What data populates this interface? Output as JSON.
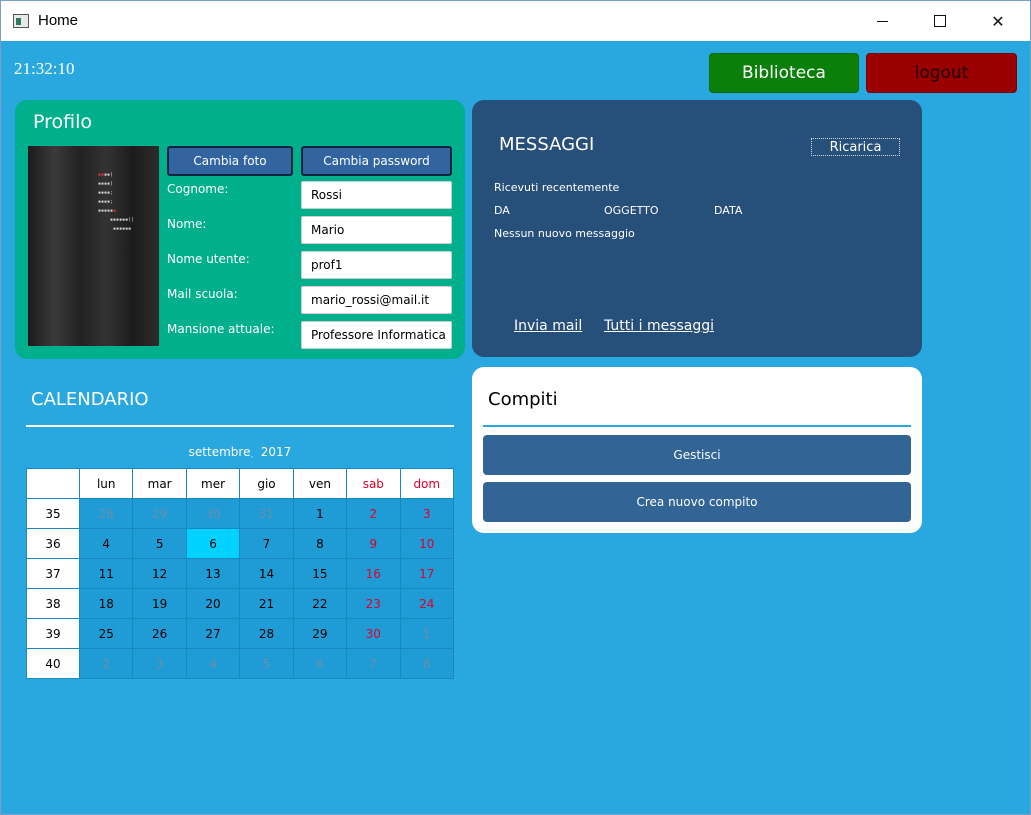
{
  "window": {
    "title": "Home"
  },
  "header": {
    "clock": "21:32:10",
    "biblioteca_label": "Biblioteca",
    "logout_label": "logout"
  },
  "profilo": {
    "title": "Profilo",
    "change_photo": "Cambia foto",
    "change_password": "Cambia password",
    "fields": [
      {
        "label": "Cognome:",
        "value": "Rossi"
      },
      {
        "label": "Nome:",
        "value": "Mario"
      },
      {
        "label": "Nome utente:",
        "value": "prof1"
      },
      {
        "label": "Mail scuola:",
        "value": "mario_rossi@mail.it"
      },
      {
        "label": "Mansione attuale:",
        "value": "Professore Informatica"
      }
    ]
  },
  "messaggi": {
    "title": "MESSAGGI",
    "reload": "Ricarica",
    "recent": "Ricevuti recentemente",
    "col_from": "DA",
    "col_subject": "OGGETTO",
    "col_date": "DATA",
    "empty": "Nessun nuovo messaggio",
    "send_mail": "Invia mail",
    "all_messages": "Tutti i messaggi"
  },
  "compiti": {
    "title": "Compiti",
    "manage": "Gestisci",
    "create": "Crea nuovo compito"
  },
  "calendario": {
    "title": "CALENDARIO",
    "month": "settembre",
    "year": "2017",
    "weekdays": [
      "lun",
      "mar",
      "mer",
      "gio",
      "ven",
      "sab",
      "dom"
    ],
    "weeks": [
      {
        "num": "35",
        "days": [
          "28",
          "29",
          "30",
          "31",
          "1",
          "2",
          "3"
        ]
      },
      {
        "num": "36",
        "days": [
          "4",
          "5",
          "6",
          "7",
          "8",
          "9",
          "10"
        ]
      },
      {
        "num": "37",
        "days": [
          "11",
          "12",
          "13",
          "14",
          "15",
          "16",
          "17"
        ]
      },
      {
        "num": "38",
        "days": [
          "18",
          "19",
          "20",
          "21",
          "22",
          "23",
          "24"
        ]
      },
      {
        "num": "39",
        "days": [
          "25",
          "26",
          "27",
          "28",
          "29",
          "30",
          "1"
        ]
      },
      {
        "num": "40",
        "days": [
          "2",
          "3",
          "4",
          "5",
          "6",
          "7",
          "8"
        ]
      }
    ],
    "selected_day": "6",
    "colors": {
      "weekend": "#e0002a",
      "other_month": "#6b8fa8",
      "selected": "#00d2ff"
    }
  }
}
